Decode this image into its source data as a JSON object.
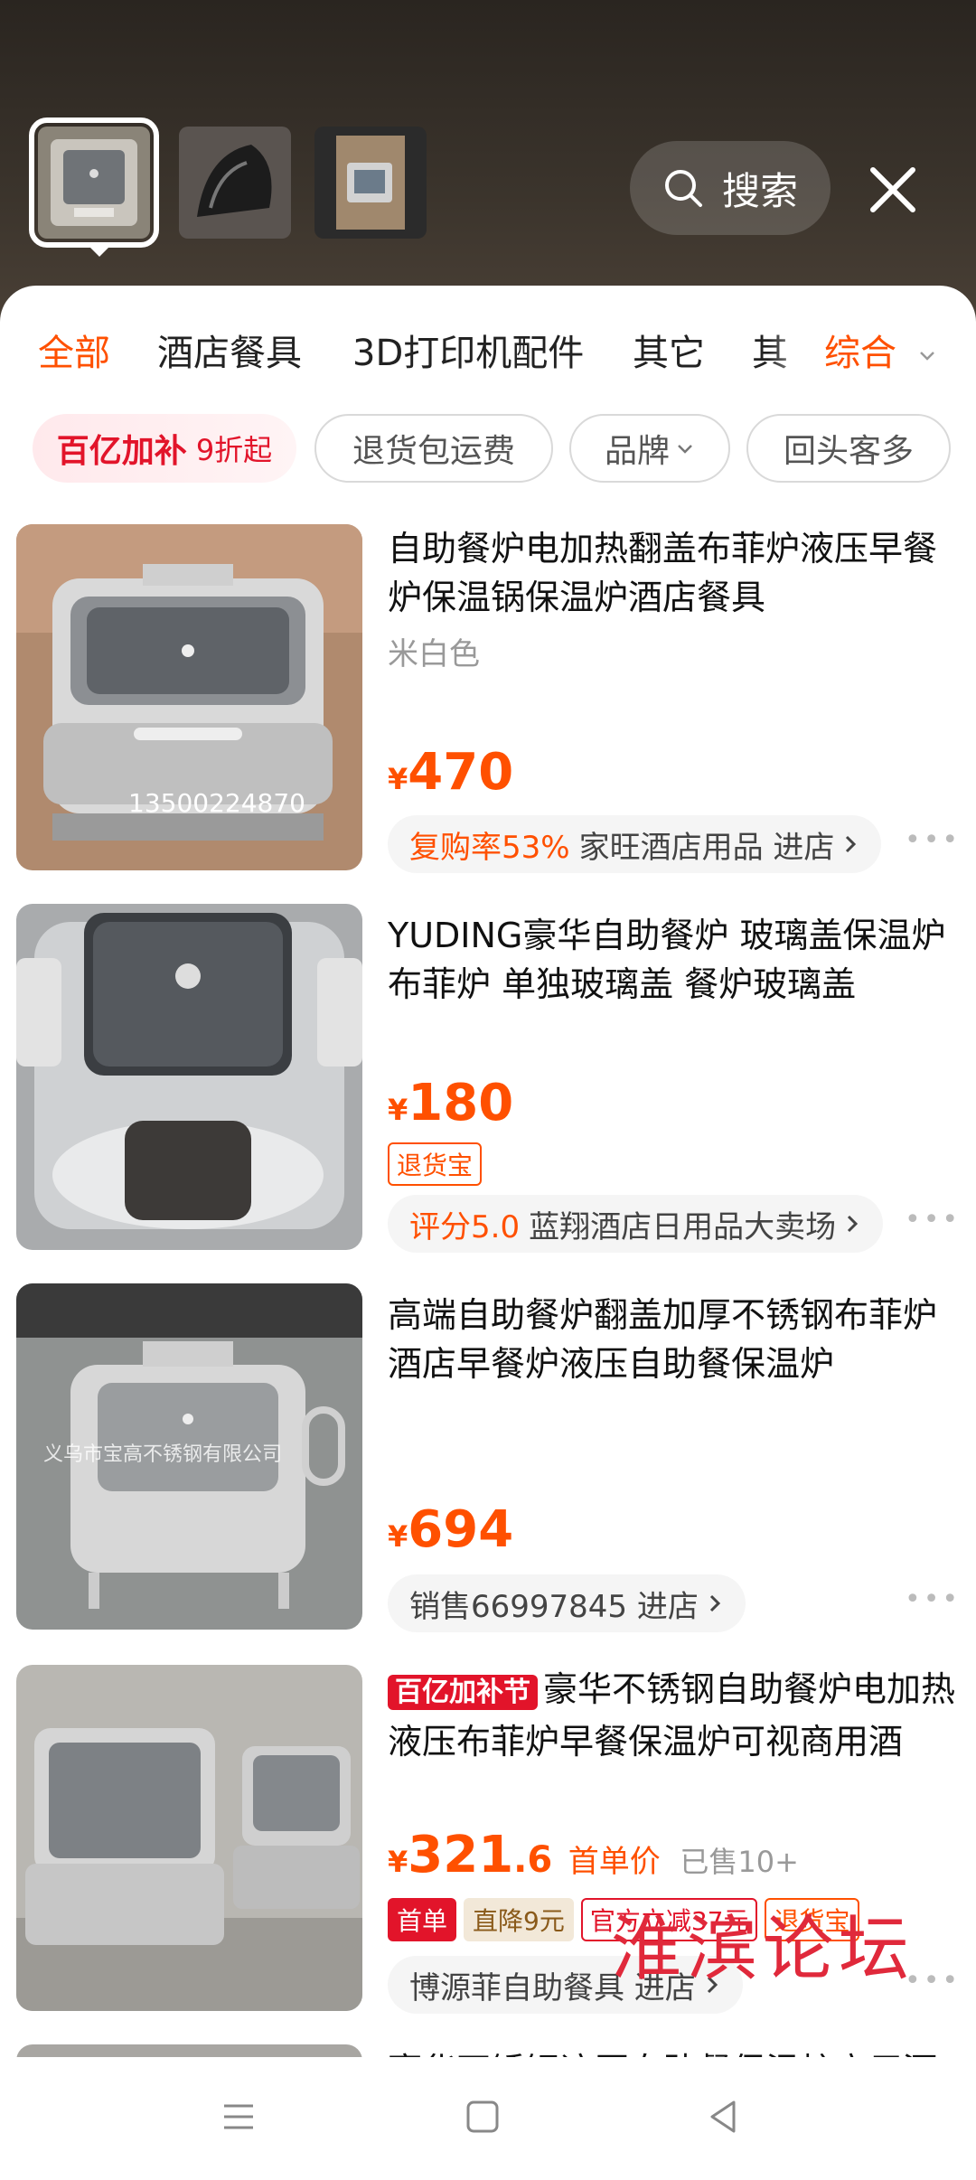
{
  "search": {
    "label": "搜索"
  },
  "categories": [
    "全部",
    "酒店餐具",
    "3D打印机配件",
    "其它",
    "其"
  ],
  "sort": {
    "label": "综合"
  },
  "filters": {
    "promo_main": "百亿加补",
    "promo_sub": "9折起",
    "chip1": "退货包运费",
    "chip2": "品牌",
    "chip3": "回头客多"
  },
  "products": [
    {
      "title": "自助餐炉电加热翻盖布菲炉液压早餐炉保温锅保温炉酒店餐具",
      "variant": "米白色",
      "yen": "¥",
      "price": "470",
      "store_highlight": "复购率53%",
      "store": "家旺酒店用品 进店",
      "image_text": "13500224870"
    },
    {
      "title": "YUDING豪华自助餐炉 玻璃盖保温炉布菲炉 单独玻璃盖 餐炉玻璃盖",
      "yen": "¥",
      "price": "180",
      "tag": "退货宝",
      "store_highlight": "评分5.0",
      "store": "蓝翔酒店日用品大卖场"
    },
    {
      "title": "高端自助餐炉翻盖加厚不锈钢布菲炉酒店早餐炉液压自助餐保温炉",
      "yen": "¥",
      "price": "694",
      "store": "销售66997845 进店",
      "image_text": "义乌市宝高不锈钢有限公司"
    },
    {
      "badge": "百亿加补节",
      "title": "豪华不锈钢自助餐炉电加热液压布菲炉早餐保温炉可视商用酒",
      "yen": "¥",
      "price_int": "321",
      "price_dec": ".6",
      "price_label": "首单价",
      "sold": "已售10+",
      "tag1": "首单",
      "tag2": "直降9元",
      "tag3": "官方立减37元",
      "tag4": "退货宝",
      "store": "博源菲自助餐具 进店"
    },
    {
      "title": "豪华不锈钢液压自助餐保温炉商用酒"
    }
  ],
  "watermark": "淮滨论坛",
  "colors": {
    "accent": "#ff5000",
    "promo": "#e2142a"
  }
}
